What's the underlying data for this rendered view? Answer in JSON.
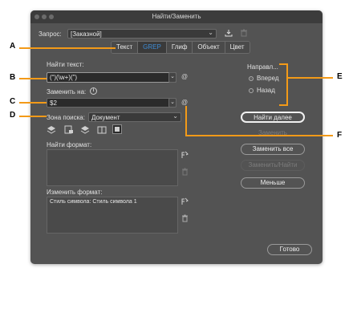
{
  "window": {
    "title": "Найти/Заменить"
  },
  "query": {
    "label": "Запрос:",
    "value": "[Заказной]"
  },
  "tabs": [
    "Текст",
    "GREP",
    "Глиф",
    "Объект",
    "Цвет"
  ],
  "find_text": {
    "label": "Найти текст:",
    "value": "(“)(\\w+)(”)"
  },
  "replace": {
    "label": "Заменить на:",
    "value": "$2"
  },
  "search": {
    "label": "Зона поиска:",
    "value": "Документ"
  },
  "find_format": {
    "label": "Найти формат:",
    "value": ""
  },
  "change_format": {
    "label": "Изменить формат:",
    "value": "Стиль символа: Стиль символа 1"
  },
  "direction": {
    "label": "Направл...",
    "forward": "Вперед",
    "backward": "Назад"
  },
  "buttons": {
    "find_next": "Найти далее",
    "replace": "Заменить",
    "replace_all": "Заменить все",
    "replace_find": "Заменить/Найти",
    "less": "Меньше",
    "done": "Готово"
  },
  "callouts": {
    "a": "A",
    "b": "B",
    "c": "C",
    "d": "D",
    "e": "E",
    "f": "F"
  },
  "glyphs": {
    "at": "@",
    "dropdown": "⌄",
    "info": "i"
  }
}
